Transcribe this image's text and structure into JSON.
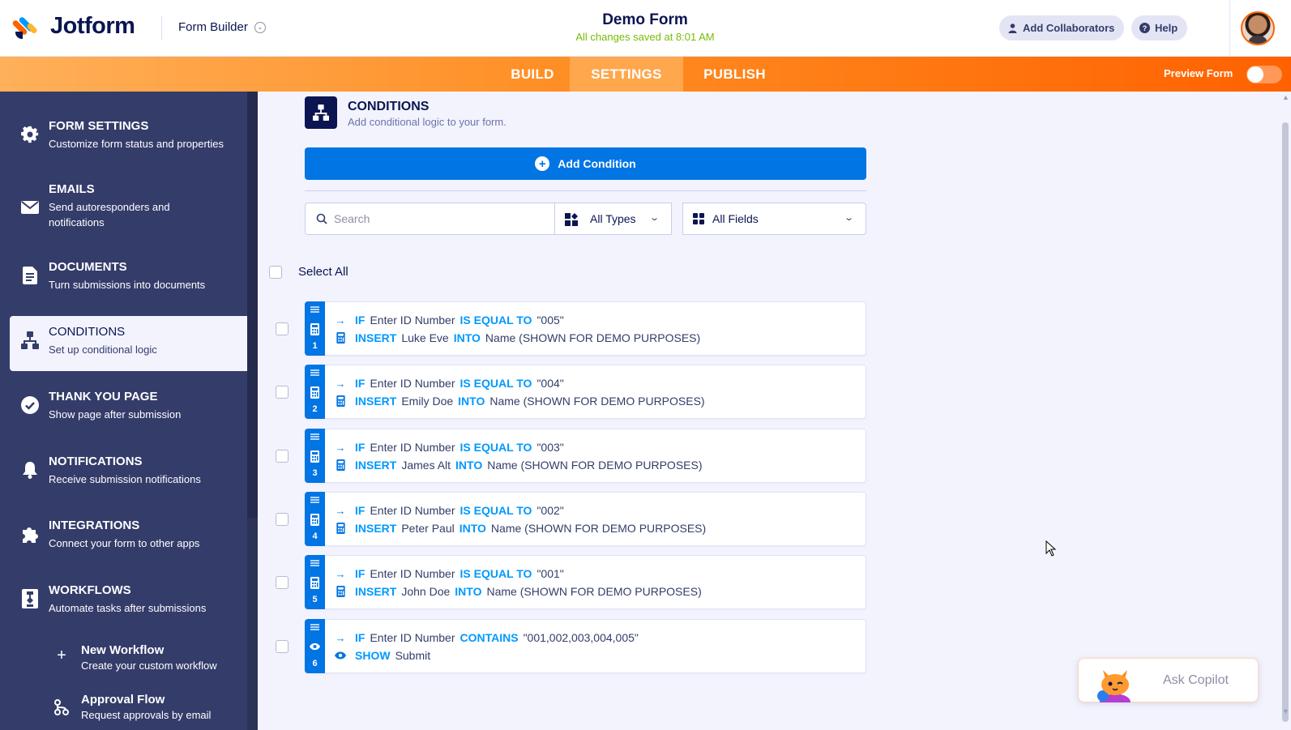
{
  "header": {
    "brand": "Jotform",
    "builder_label": "Form Builder",
    "form_title": "Demo Form",
    "save_status": "All changes saved at 8:01 AM",
    "add_collaborators": "Add Collaborators",
    "help": "Help"
  },
  "nav": {
    "tabs": [
      "BUILD",
      "SETTINGS",
      "PUBLISH"
    ],
    "active_tab": "SETTINGS",
    "preview_label": "Preview Form",
    "preview_enabled": false
  },
  "sidebar": {
    "items": [
      {
        "title": "FORM SETTINGS",
        "desc": "Customize form status and properties",
        "icon": "gear-icon"
      },
      {
        "title": "EMAILS",
        "desc": "Send autoresponders and notifications",
        "icon": "envelope-icon"
      },
      {
        "title": "DOCUMENTS",
        "desc": "Turn submissions into documents",
        "icon": "document-icon"
      },
      {
        "title": "CONDITIONS",
        "desc": "Set up conditional logic",
        "icon": "sitemap-icon"
      },
      {
        "title": "THANK YOU PAGE",
        "desc": "Show page after submission",
        "icon": "check-circle-icon"
      },
      {
        "title": "NOTIFICATIONS",
        "desc": "Receive submission notifications",
        "icon": "bell-icon"
      },
      {
        "title": "INTEGRATIONS",
        "desc": "Connect your form to other apps",
        "icon": "puzzle-icon"
      },
      {
        "title": "WORKFLOWS",
        "desc": "Automate tasks after submissions",
        "icon": "workflow-icon"
      }
    ],
    "active_index": 3,
    "workflow_subitems": [
      {
        "title": "New Workflow",
        "desc": "Create your custom workflow",
        "icon": "plus-icon"
      },
      {
        "title": "Approval Flow",
        "desc": "Request approvals by email",
        "icon": "flow-icon"
      }
    ]
  },
  "conditions": {
    "title": "CONDITIONS",
    "subtitle": "Add conditional logic to your form.",
    "add_button": "Add Condition",
    "search_placeholder": "Search",
    "type_filter": "All Types",
    "field_filter": "All Fields",
    "select_all": "Select All",
    "rules": [
      {
        "num": "1",
        "type": "calculator-icon",
        "if_kw": "IF",
        "field": "Enter ID Number",
        "op": "IS EQUAL TO",
        "value": "\"005\"",
        "action_kw": "INSERT",
        "action_value": "Luke Eve",
        "into_kw": "INTO",
        "target": "Name (SHOWN FOR DEMO PURPOSES)"
      },
      {
        "num": "2",
        "type": "calculator-icon",
        "if_kw": "IF",
        "field": "Enter ID Number",
        "op": "IS EQUAL TO",
        "value": "\"004\"",
        "action_kw": "INSERT",
        "action_value": "Emily Doe",
        "into_kw": "INTO",
        "target": "Name (SHOWN FOR DEMO PURPOSES)"
      },
      {
        "num": "3",
        "type": "calculator-icon",
        "if_kw": "IF",
        "field": "Enter ID Number",
        "op": "IS EQUAL TO",
        "value": "\"003\"",
        "action_kw": "INSERT",
        "action_value": "James Alt",
        "into_kw": "INTO",
        "target": "Name (SHOWN FOR DEMO PURPOSES)"
      },
      {
        "num": "4",
        "type": "calculator-icon",
        "if_kw": "IF",
        "field": "Enter ID Number",
        "op": "IS EQUAL TO",
        "value": "\"002\"",
        "action_kw": "INSERT",
        "action_value": "Peter Paul",
        "into_kw": "INTO",
        "target": "Name (SHOWN FOR DEMO PURPOSES)"
      },
      {
        "num": "5",
        "type": "calculator-icon",
        "if_kw": "IF",
        "field": "Enter ID Number",
        "op": "IS EQUAL TO",
        "value": "\"001\"",
        "action_kw": "INSERT",
        "action_value": "John Doe",
        "into_kw": "INTO",
        "target": "Name (SHOWN FOR DEMO PURPOSES)"
      },
      {
        "num": "6",
        "type": "eye-icon",
        "if_kw": "IF",
        "field": "Enter ID Number",
        "op": "CONTAINS",
        "value": "\"001,002,003,004,005\"",
        "action_kw": "SHOW",
        "action_value": "Submit",
        "into_kw": "",
        "target": ""
      }
    ]
  },
  "copilot": {
    "label": "Ask Copilot"
  },
  "colors": {
    "accent_orange": "#ff6100",
    "primary_blue": "#0075e3",
    "keyword_blue": "#0099ff",
    "sidebar_bg": "#343c6a",
    "navy": "#0a1551",
    "saved_green": "#78bb07"
  }
}
